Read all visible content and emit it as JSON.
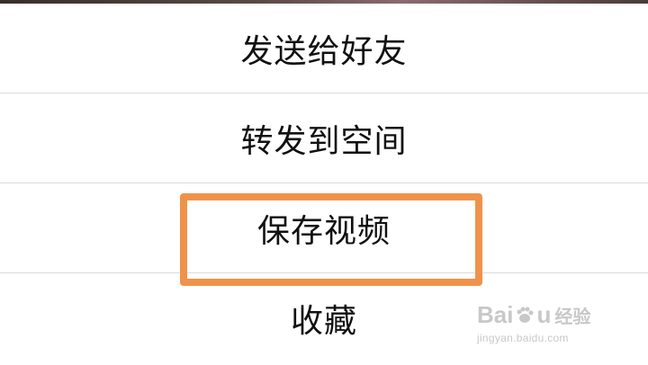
{
  "share_menu": {
    "items": [
      {
        "label": "发送给好友"
      },
      {
        "label": "转发到空间"
      },
      {
        "label": "保存视频"
      },
      {
        "label": "收藏"
      }
    ],
    "highlighted_item": "保存视频"
  },
  "colors": {
    "highlight_border": "#f0924a",
    "divider": "#dcdcdc",
    "text": "#111111"
  },
  "watermark": {
    "logo_text_left": "Bai",
    "logo_text_right": "u",
    "logo_cn": "经验",
    "url": "jingyan.baidu.com"
  }
}
